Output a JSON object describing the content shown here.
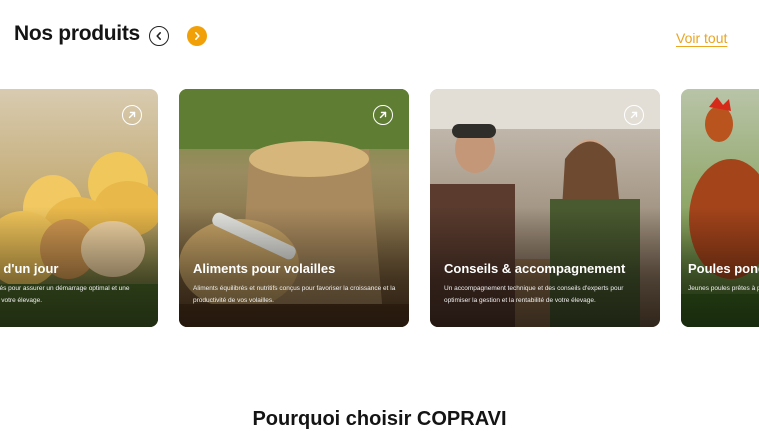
{
  "header": {
    "title": "Nos produits",
    "prev_icon": "chevron-left-icon",
    "next_icon": "chevron-right-icon",
    "see_all": "Voir tout",
    "accent_color": "#f2a007"
  },
  "cards": [
    {
      "title": "Poussins d'un jour",
      "description": "Poussins sélectionnés pour assurer un démarrage optimal et une croissance saine de votre élevage.",
      "icon": "arrow-up-right-icon"
    },
    {
      "title": "Aliments pour volailles",
      "description": "Aliments équilibrés et nutritifs conçus pour favoriser la croissance et la productivité de vos volailles.",
      "icon": "arrow-up-right-icon"
    },
    {
      "title": "Conseils & accompagnement",
      "description": "Un accompagnement technique et des conseils d'experts pour optimiser la gestion et la rentabilité de votre élevage.",
      "icon": "arrow-up-right-icon"
    },
    {
      "title": "Poules pondeuses",
      "description": "Jeunes poules prêtes à pondre pour une production d'œufs",
      "icon": "arrow-up-right-icon"
    }
  ],
  "section": {
    "title": "Pourquoi choisir COPRAVI"
  }
}
